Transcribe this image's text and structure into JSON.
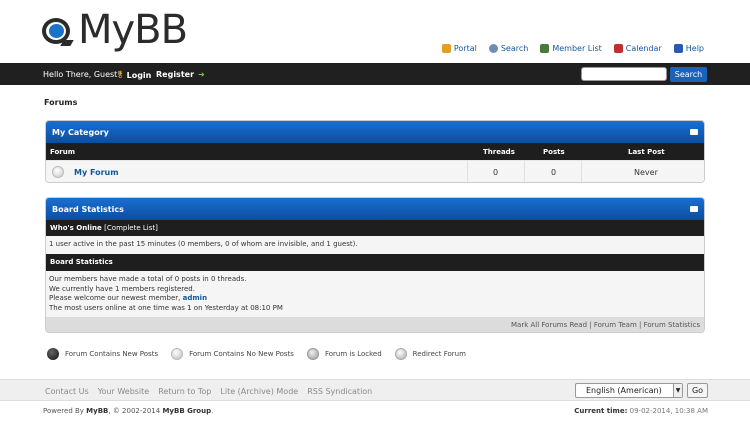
{
  "brand": {
    "logo_text": "MyBB"
  },
  "toplinks": [
    {
      "label": "Portal",
      "icon": "portal-icon",
      "color": "#e0a020"
    },
    {
      "label": "Search",
      "icon": "search-icon",
      "color": "#6a8fb5"
    },
    {
      "label": "Member List",
      "icon": "member-list-icon",
      "color": "#4a7a3a"
    },
    {
      "label": "Calendar",
      "icon": "calendar-icon",
      "color": "#c03030"
    },
    {
      "label": "Help",
      "icon": "help-icon",
      "color": "#2a5ab0"
    }
  ],
  "userbar": {
    "greeting": "Hello There, Guest!",
    "login_label": "Login",
    "register_label": "Register",
    "search_placeholder": "",
    "search_button": "Search"
  },
  "breadcrumb": "Forums",
  "category": {
    "title": "My Category",
    "columns": {
      "forum": "Forum",
      "threads": "Threads",
      "posts": "Posts",
      "last_post": "Last Post"
    },
    "forums": [
      {
        "name": "My Forum",
        "threads": "0",
        "posts": "0",
        "last_post": "Never"
      }
    ]
  },
  "board_stats": {
    "title": "Board Statistics",
    "whos_online_label": "Who's Online",
    "complete_list": "[Complete List]",
    "online_summary": "1 user active in the past 15 minutes (0 members, 0 of whom are invisible, and 1 guest).",
    "stats_header": "Board Statistics",
    "line1": "Our members have made a total of 0 posts in 0 threads.",
    "line2": "We currently have 1 members registered.",
    "line3_prefix": "Please welcome our newest member,",
    "newest_member": "admin",
    "line4": "The most users online at one time was 1 on Yesterday at 08:10 PM",
    "footer_links": "Mark All Forums Read | Forum Team | Forum Statistics"
  },
  "legend": [
    {
      "label": "Forum Contains New Posts",
      "icon": "forum-new-posts-icon"
    },
    {
      "label": "Forum Contains No New Posts",
      "icon": "forum-no-new-posts-icon"
    },
    {
      "label": "Forum is Locked",
      "icon": "forum-locked-icon"
    },
    {
      "label": "Redirect Forum",
      "icon": "redirect-forum-icon"
    }
  ],
  "footer": {
    "links": [
      "Contact Us",
      "Your Website",
      "Return to Top",
      "Lite (Archive) Mode",
      "RSS Syndication"
    ],
    "language": "English (American)",
    "go_label": "Go",
    "powered_prefix": "Powered By",
    "powered_mybb": "MyBB",
    "powered_mid": ", © 2002-2014",
    "powered_group": "MyBB Group",
    "powered_end": ".",
    "time_label": "Current time:",
    "time_value": "09-02-2014, 10:38 AM"
  }
}
